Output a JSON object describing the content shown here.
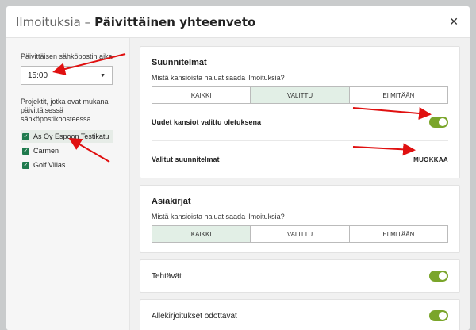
{
  "modal": {
    "title_prefix": "Ilmoituksia –",
    "title_main": "Päivittäinen yhteenveto",
    "close_label": "✕"
  },
  "left": {
    "time_label": "Päivittäisen sähköpostin aika",
    "time_value": "15:00",
    "projects_label": "Projektit, jotka ovat mukana päivittäisessä sähköpostikoosteessa",
    "projects": [
      {
        "label": "As Oy Espoon Testikatu",
        "checked": true
      },
      {
        "label": "Carmen",
        "checked": true
      },
      {
        "label": "Golf Villas",
        "checked": true
      }
    ]
  },
  "suunnitelmat": {
    "title": "Suunnitelmat",
    "question": "Mistä kansioista haluat saada ilmoituksia?",
    "options": [
      "KAIKKI",
      "VALITTU",
      "EI MITÄÄN"
    ],
    "selected": "VALITTU",
    "new_folders_label": "Uudet kansiot valittu oletuksena",
    "new_folders_on": true,
    "selected_plans_label": "Valitut suunnitelmat",
    "edit_label": "MUOKKAA"
  },
  "asiakirjat": {
    "title": "Asiakirjat",
    "question": "Mistä kansioista haluat saada ilmoituksia?",
    "options": [
      "KAIKKI",
      "VALITTU",
      "EI MITÄÄN"
    ],
    "selected": "KAIKKI"
  },
  "tehtavat": {
    "label": "Tehtävät",
    "on": true
  },
  "allekirjoitukset": {
    "label": "Allekirjoitukset odottavat",
    "on": true
  },
  "colors": {
    "accent_green": "#1f7a4d",
    "toggle_green": "#7aa52a",
    "arrow_red": "#e01010"
  }
}
